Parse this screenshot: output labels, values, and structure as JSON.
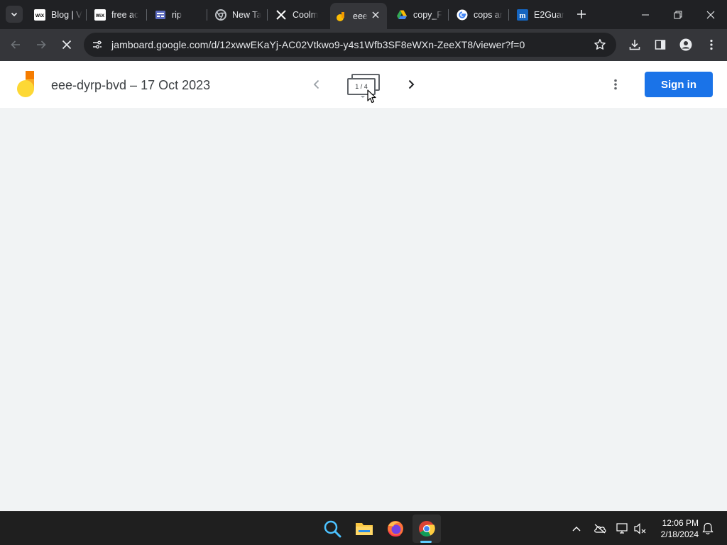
{
  "browser": {
    "tabs": [
      {
        "title": "Blog | V",
        "icon": "wix-icon"
      },
      {
        "title": "free ac",
        "icon": "wix-icon"
      },
      {
        "title": "rip",
        "icon": "forms-icon"
      },
      {
        "title": "New Ta",
        "icon": "chrome-icon"
      },
      {
        "title": "Coolm",
        "icon": "x-icon"
      },
      {
        "title": "eee",
        "icon": "jamboard-icon"
      },
      {
        "title": "copy_F",
        "icon": "drive-icon"
      },
      {
        "title": "cops ar",
        "icon": "google-icon"
      },
      {
        "title": "E2Guar",
        "icon": "m-icon"
      }
    ],
    "active_tab_index": 5,
    "url": "jamboard.google.com/d/12xwwEKaYj-AC02Vtkwo9-y4s1Wfb3SF8eWXn-ZeeXT8/viewer?f=0"
  },
  "jamboard": {
    "title": "eee-dyrp-bvd – 17 Oct 2023",
    "frame_counter": "1 / 4",
    "sign_in_label": "Sign in"
  },
  "taskbar": {
    "apps": [
      "search-icon",
      "file-explorer-icon",
      "firefox-icon",
      "chrome-icon"
    ],
    "time": "12:06 PM",
    "date": "2/18/2024"
  },
  "colors": {
    "accent": "#1a73e8",
    "tabstrip": "#202124",
    "toolbar": "#35363a",
    "canvas": "#f1f3f4"
  }
}
